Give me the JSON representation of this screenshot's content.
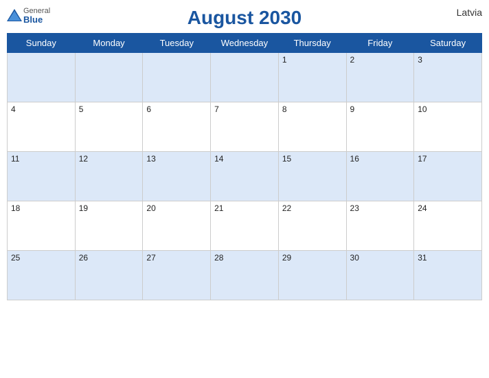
{
  "header": {
    "title": "August 2030",
    "country": "Latvia",
    "logo": {
      "general": "General",
      "blue": "Blue"
    }
  },
  "weekdays": [
    "Sunday",
    "Monday",
    "Tuesday",
    "Wednesday",
    "Thursday",
    "Friday",
    "Saturday"
  ],
  "weeks": [
    [
      null,
      null,
      null,
      null,
      1,
      2,
      3
    ],
    [
      4,
      5,
      6,
      7,
      8,
      9,
      10
    ],
    [
      11,
      12,
      13,
      14,
      15,
      16,
      17
    ],
    [
      18,
      19,
      20,
      21,
      22,
      23,
      24
    ],
    [
      25,
      26,
      27,
      28,
      29,
      30,
      31
    ]
  ]
}
